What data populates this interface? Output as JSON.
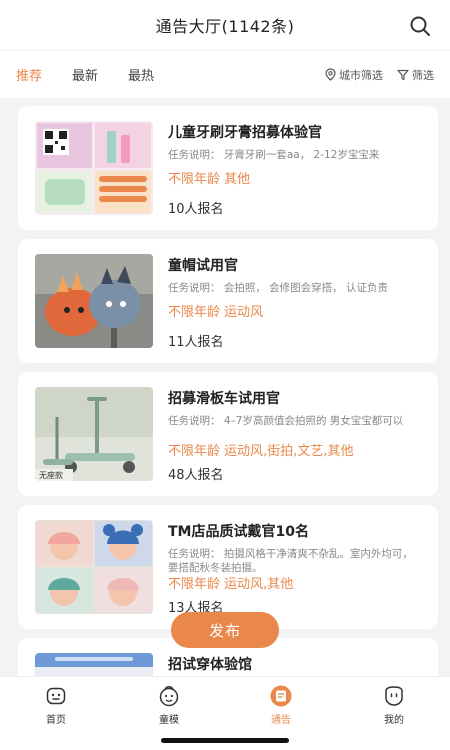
{
  "header": {
    "title": "通告大厅(1142条)",
    "search_icon": "search-icon"
  },
  "filter": {
    "tabs": [
      {
        "label": "推荐",
        "active": true
      },
      {
        "label": "最新",
        "active": false
      },
      {
        "label": "最热",
        "active": false
      }
    ],
    "city_label": "城市筛选",
    "filter_label": "筛选"
  },
  "cards": [
    {
      "title": "儿童牙刷牙膏招募体验官",
      "desc": "任务说明：  牙膏牙刷一套aa，  2-12岁宝宝来",
      "tags": "不限年龄   其他",
      "count": "10人报名"
    },
    {
      "title": "童帽试用官",
      "desc": "任务说明：  会拍照，  会修图会穿搭，  认证负责",
      "tags": "不限年龄   运动风",
      "count": "11人报名"
    },
    {
      "title": "招募滑板车试用官",
      "desc": "任务说明：  4–7岁高颜值会拍照的 男女宝宝都可以",
      "tags": "不限年龄   运动风,街拍,文艺,其他",
      "count": "48人报名",
      "thumb_badge": "无座款"
    },
    {
      "title": "TM店品质试戴官10名",
      "desc": "任务说明：  拍摄风格干净清爽不杂乱。室内外均可，  要搭配秋冬装拍摄。",
      "tags": "不限年龄   运动风,其他",
      "count": "13人报名"
    },
    {
      "title": "招试穿体验馆",
      "desc": "",
      "tags": "",
      "count": ""
    }
  ],
  "publish_label": "发布",
  "tabbar": [
    {
      "label": "首页",
      "icon": "home-icon",
      "active": false
    },
    {
      "label": "童模",
      "icon": "kid-model-icon",
      "active": false
    },
    {
      "label": "通告",
      "icon": "notice-icon",
      "active": true
    },
    {
      "label": "我的",
      "icon": "profile-icon",
      "active": false
    }
  ],
  "colors": {
    "accent": "#e9884a",
    "background": "#f3f3f3"
  }
}
